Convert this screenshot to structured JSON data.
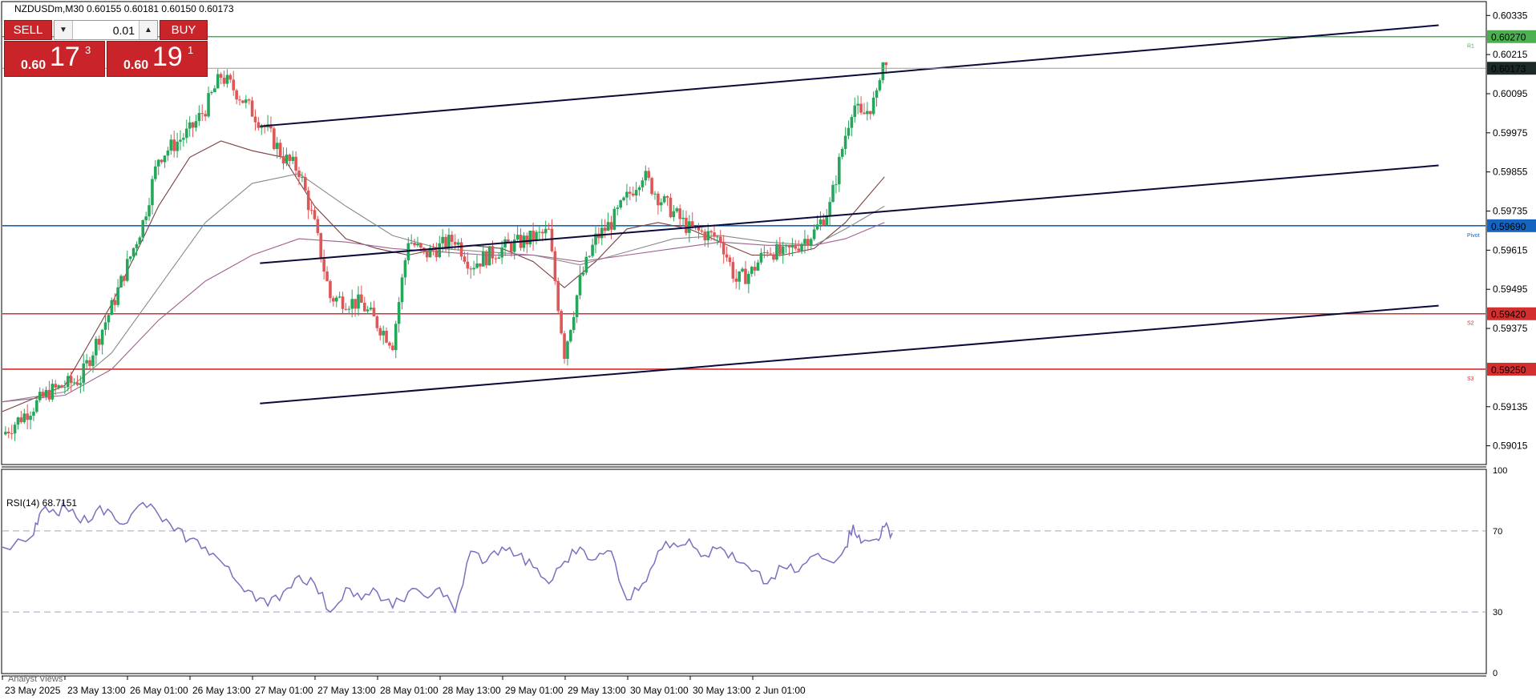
{
  "symbol": {
    "text": "NZDUSDm,M30  0.60155 0.60181 0.60150 0.60173"
  },
  "trade_panel": {
    "sell_label": "SELL",
    "buy_label": "BUY",
    "lot_value": "0.01",
    "sell_small": "0.60",
    "sell_big": "17",
    "sell_sup": "3",
    "buy_small": "0.60",
    "buy_big": "19",
    "buy_sup": "1"
  },
  "rsi_label": "RSI(14) 68.7151",
  "analyst_label": "Analyst Views",
  "chart_data": {
    "type": "candlestick",
    "price_axis": {
      "range": [
        0.5896,
        0.60375
      ],
      "ticks": [
        "0.60335",
        "0.60215",
        "0.60095",
        "0.59975",
        "0.59855",
        "0.59735",
        "0.59615",
        "0.59495",
        "0.59375",
        "0.59135",
        "0.59015"
      ]
    },
    "time_axis": {
      "labels": [
        "23 May 2025",
        "23 May 13:00",
        "26 May 01:00",
        "26 May 13:00",
        "27 May 01:00",
        "27 May 13:00",
        "28 May 01:00",
        "28 May 13:00",
        "29 May 01:00",
        "29 May 13:00",
        "30 May 01:00",
        "30 May 13:00",
        "2 Jun 01:00"
      ]
    },
    "current_price": 0.60173,
    "horizontal_levels": [
      {
        "name": "R1",
        "price": 0.6027,
        "label": "0.60270",
        "tag": "R1",
        "color": "#4caf50"
      },
      {
        "name": "Pivot",
        "price": 0.5969,
        "label": "0.59690",
        "tag": "Pivot",
        "color": "#1565c0"
      },
      {
        "name": "S2",
        "price": 0.5942,
        "label": "0.59420",
        "tag": "S2",
        "color": "#d32f2f"
      },
      {
        "name": "S3",
        "price": 0.5925,
        "label": "0.59250",
        "tag": "S3",
        "color": "#d32f2f"
      }
    ],
    "channel_lines": [
      {
        "from": [
          16.5,
          0.59995
        ],
        "to": [
          92.0,
          0.60305
        ]
      },
      {
        "from": [
          16.5,
          0.59575
        ],
        "to": [
          92.0,
          0.59875
        ]
      },
      {
        "from": [
          16.5,
          0.59145
        ],
        "to": [
          92.0,
          0.59445
        ]
      }
    ],
    "price_path": [
      [
        0,
        0.5905
      ],
      [
        3,
        0.5918
      ],
      [
        5,
        0.5922
      ],
      [
        7,
        0.5944
      ],
      [
        9,
        0.597
      ],
      [
        10,
        0.599
      ],
      [
        12,
        0.5998
      ],
      [
        13,
        0.6005
      ],
      [
        14,
        0.6015
      ],
      [
        15,
        0.601
      ],
      [
        17,
        0.5998
      ],
      [
        18,
        0.599
      ],
      [
        19,
        0.5986
      ],
      [
        20,
        0.5969
      ],
      [
        21,
        0.5947
      ],
      [
        23,
        0.5945
      ],
      [
        25,
        0.5933
      ],
      [
        26,
        0.5965
      ],
      [
        27,
        0.596
      ],
      [
        29,
        0.5965
      ],
      [
        30,
        0.5957
      ],
      [
        32,
        0.5962
      ],
      [
        35,
        0.5967
      ],
      [
        36,
        0.593
      ],
      [
        37,
        0.5952
      ],
      [
        38,
        0.5965
      ],
      [
        39,
        0.597
      ],
      [
        41,
        0.5985
      ],
      [
        42,
        0.5978
      ],
      [
        44,
        0.5968
      ],
      [
        46,
        0.5965
      ],
      [
        47,
        0.5952
      ],
      [
        48,
        0.5955
      ],
      [
        49,
        0.5962
      ],
      [
        50,
        0.596
      ],
      [
        52,
        0.5967
      ],
      [
        53,
        0.5975
      ],
      [
        53.9,
        0.5995
      ],
      [
        54.5,
        0.6007
      ],
      [
        55,
        0.6002
      ],
      [
        56,
        0.6008
      ],
      [
        56.3,
        0.602
      ],
      [
        56.6,
        0.60172
      ]
    ],
    "moving_averages": [
      {
        "color": "#7b3f3f",
        "points": [
          [
            0,
            0.5912
          ],
          [
            4,
            0.592
          ],
          [
            7,
            0.5945
          ],
          [
            10,
            0.5975
          ],
          [
            12,
            0.599
          ],
          [
            14,
            0.5995
          ],
          [
            16,
            0.5992
          ],
          [
            18,
            0.599
          ],
          [
            20,
            0.5975
          ],
          [
            22,
            0.5965
          ],
          [
            24,
            0.5962
          ],
          [
            26,
            0.596
          ],
          [
            28,
            0.5962
          ],
          [
            30,
            0.5963
          ],
          [
            32,
            0.5962
          ],
          [
            34,
            0.5958
          ],
          [
            36,
            0.595
          ],
          [
            38,
            0.5958
          ],
          [
            40,
            0.5968
          ],
          [
            42,
            0.597
          ],
          [
            44,
            0.5968
          ],
          [
            46,
            0.5964
          ],
          [
            48,
            0.596
          ],
          [
            50,
            0.596
          ],
          [
            52,
            0.5962
          ],
          [
            54,
            0.597
          ],
          [
            56.5,
            0.5984
          ]
        ]
      },
      {
        "color": "#8a8a8a",
        "points": [
          [
            0,
            0.5915
          ],
          [
            4,
            0.5918
          ],
          [
            7,
            0.593
          ],
          [
            10,
            0.595
          ],
          [
            13,
            0.597
          ],
          [
            16,
            0.5982
          ],
          [
            19,
            0.5985
          ],
          [
            22,
            0.5975
          ],
          [
            25,
            0.5966
          ],
          [
            28,
            0.5962
          ],
          [
            31,
            0.5961
          ],
          [
            34,
            0.596
          ],
          [
            37,
            0.5957
          ],
          [
            40,
            0.5961
          ],
          [
            43,
            0.5965
          ],
          [
            46,
            0.5966
          ],
          [
            49,
            0.5964
          ],
          [
            52,
            0.5963
          ],
          [
            54,
            0.5968
          ],
          [
            56.5,
            0.5975
          ]
        ]
      },
      {
        "color": "#a06090",
        "points": [
          [
            0,
            0.5915
          ],
          [
            4,
            0.5917
          ],
          [
            7,
            0.5925
          ],
          [
            10,
            0.594
          ],
          [
            13,
            0.5952
          ],
          [
            16,
            0.596
          ],
          [
            19,
            0.5965
          ],
          [
            22,
            0.5964
          ],
          [
            25,
            0.5962
          ],
          [
            28,
            0.5961
          ],
          [
            31,
            0.596
          ],
          [
            34,
            0.596
          ],
          [
            37,
            0.5958
          ],
          [
            40,
            0.596
          ],
          [
            43,
            0.5962
          ],
          [
            46,
            0.5964
          ],
          [
            49,
            0.5963
          ],
          [
            52,
            0.5963
          ],
          [
            54,
            0.5965
          ],
          [
            56.5,
            0.597
          ]
        ]
      }
    ],
    "rsi": {
      "range": [
        0,
        100
      ],
      "ticks": [
        "100",
        "70",
        "30",
        "0"
      ],
      "levels": [
        70,
        30
      ],
      "color": "#7a6fc0",
      "path": [
        [
          0,
          62
        ],
        [
          2,
          68
        ],
        [
          2.5,
          80
        ],
        [
          3.5,
          78
        ],
        [
          4,
          82
        ],
        [
          5,
          74
        ],
        [
          6,
          80
        ],
        [
          7,
          79
        ],
        [
          8,
          74
        ],
        [
          9,
          84
        ],
        [
          10,
          78
        ],
        [
          11,
          70
        ],
        [
          12,
          66
        ],
        [
          13,
          62
        ],
        [
          14,
          55
        ],
        [
          15,
          45
        ],
        [
          16,
          40
        ],
        [
          17,
          33
        ],
        [
          18,
          40
        ],
        [
          19,
          48
        ],
        [
          20,
          44
        ],
        [
          21,
          30
        ],
        [
          22,
          42
        ],
        [
          23,
          36
        ],
        [
          24,
          40
        ],
        [
          25,
          32
        ],
        [
          26,
          40
        ],
        [
          27,
          38
        ],
        [
          28,
          42
        ],
        [
          29,
          30
        ],
        [
          30,
          60
        ],
        [
          31,
          55
        ],
        [
          32,
          62
        ],
        [
          33,
          58
        ],
        [
          34,
          52
        ],
        [
          35,
          44
        ],
        [
          36,
          55
        ],
        [
          37,
          62
        ],
        [
          38,
          56
        ],
        [
          39,
          60
        ],
        [
          40,
          36
        ],
        [
          41,
          44
        ],
        [
          42,
          60
        ],
        [
          43,
          64
        ],
        [
          44,
          66
        ],
        [
          45,
          58
        ],
        [
          46,
          62
        ],
        [
          47,
          55
        ],
        [
          48,
          50
        ],
        [
          49,
          44
        ],
        [
          50,
          52
        ],
        [
          51,
          50
        ],
        [
          52,
          58
        ],
        [
          53,
          55
        ],
        [
          54,
          62
        ],
        [
          54.5,
          73
        ],
        [
          55,
          64
        ],
        [
          56,
          66
        ],
        [
          56.5,
          72
        ],
        [
          57,
          69
        ]
      ]
    },
    "x_range": [
      0,
      95
    ]
  }
}
